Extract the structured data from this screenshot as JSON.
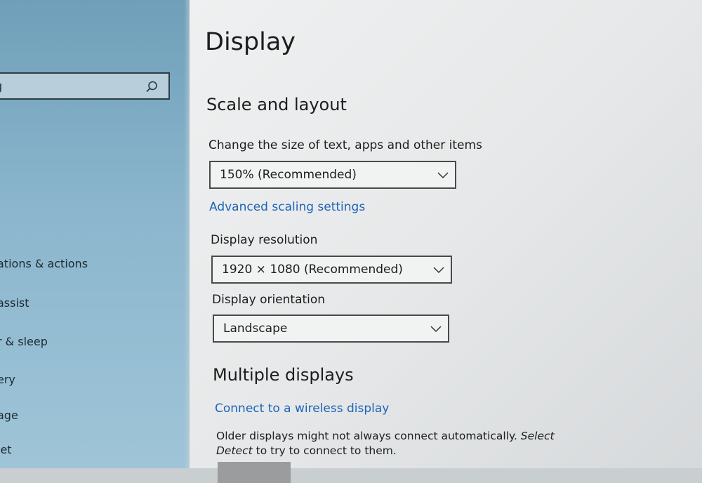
{
  "sidebar": {
    "search_text": "g",
    "items": [
      {
        "label": "ations & actions"
      },
      {
        "label": "assist"
      },
      {
        "label": "r & sleep"
      },
      {
        "label": "ery"
      },
      {
        "label": "age"
      },
      {
        "label": "let"
      }
    ]
  },
  "main": {
    "title": "Display",
    "scale_section": {
      "title": "Scale and layout",
      "scale_label": "Change the size of text, apps and other items",
      "scale_value": "150% (Recommended)",
      "advanced_link": "Advanced scaling settings",
      "resolution_label": "Display resolution",
      "resolution_value": "1920 × 1080 (Recommended)",
      "orientation_label": "Display orientation",
      "orientation_value": "Landscape"
    },
    "multiple_section": {
      "title": "Multiple displays",
      "wireless_link": "Connect to a wireless display",
      "description_normal": "Older displays might not always connect automatically. ",
      "description_italic": "Select Detect",
      "description_end": " to try to connect to them."
    }
  },
  "colors": {
    "accent_link": "#1f63b8",
    "sidebar_bg": "#8bb6cd"
  }
}
